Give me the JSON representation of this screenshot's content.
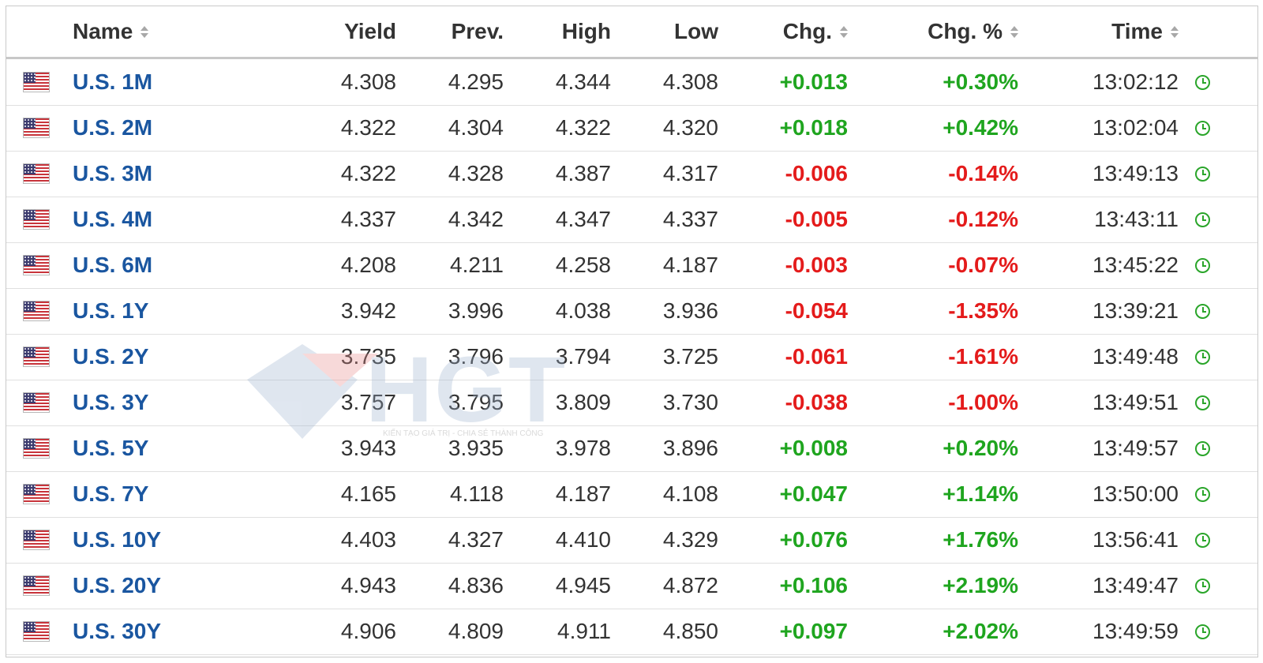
{
  "headers": {
    "name": "Name",
    "yield": "Yield",
    "prev": "Prev.",
    "high": "High",
    "low": "Low",
    "chg": "Chg.",
    "chg_pct": "Chg. %",
    "time": "Time"
  },
  "colors": {
    "up": "#1fa51f",
    "down": "#e41b1b",
    "link": "#1a56a0",
    "clock": "#2aa52a"
  },
  "rows": [
    {
      "name": "U.S. 1M",
      "yield": "4.308",
      "prev": "4.295",
      "high": "4.344",
      "low": "4.308",
      "chg": "+0.013",
      "chg_pct": "+0.30%",
      "time": "13:02:12",
      "dir": "up"
    },
    {
      "name": "U.S. 2M",
      "yield": "4.322",
      "prev": "4.304",
      "high": "4.322",
      "low": "4.320",
      "chg": "+0.018",
      "chg_pct": "+0.42%",
      "time": "13:02:04",
      "dir": "up"
    },
    {
      "name": "U.S. 3M",
      "yield": "4.322",
      "prev": "4.328",
      "high": "4.387",
      "low": "4.317",
      "chg": "-0.006",
      "chg_pct": "-0.14%",
      "time": "13:49:13",
      "dir": "down"
    },
    {
      "name": "U.S. 4M",
      "yield": "4.337",
      "prev": "4.342",
      "high": "4.347",
      "low": "4.337",
      "chg": "-0.005",
      "chg_pct": "-0.12%",
      "time": "13:43:11",
      "dir": "down"
    },
    {
      "name": "U.S. 6M",
      "yield": "4.208",
      "prev": "4.211",
      "high": "4.258",
      "low": "4.187",
      "chg": "-0.003",
      "chg_pct": "-0.07%",
      "time": "13:45:22",
      "dir": "down"
    },
    {
      "name": "U.S. 1Y",
      "yield": "3.942",
      "prev": "3.996",
      "high": "4.038",
      "low": "3.936",
      "chg": "-0.054",
      "chg_pct": "-1.35%",
      "time": "13:39:21",
      "dir": "down"
    },
    {
      "name": "U.S. 2Y",
      "yield": "3.735",
      "prev": "3.796",
      "high": "3.794",
      "low": "3.725",
      "chg": "-0.061",
      "chg_pct": "-1.61%",
      "time": "13:49:48",
      "dir": "down"
    },
    {
      "name": "U.S. 3Y",
      "yield": "3.757",
      "prev": "3.795",
      "high": "3.809",
      "low": "3.730",
      "chg": "-0.038",
      "chg_pct": "-1.00%",
      "time": "13:49:51",
      "dir": "down"
    },
    {
      "name": "U.S. 5Y",
      "yield": "3.943",
      "prev": "3.935",
      "high": "3.978",
      "low": "3.896",
      "chg": "+0.008",
      "chg_pct": "+0.20%",
      "time": "13:49:57",
      "dir": "up"
    },
    {
      "name": "U.S. 7Y",
      "yield": "4.165",
      "prev": "4.118",
      "high": "4.187",
      "low": "4.108",
      "chg": "+0.047",
      "chg_pct": "+1.14%",
      "time": "13:50:00",
      "dir": "up"
    },
    {
      "name": "U.S. 10Y",
      "yield": "4.403",
      "prev": "4.327",
      "high": "4.410",
      "low": "4.329",
      "chg": "+0.076",
      "chg_pct": "+1.76%",
      "time": "13:56:41",
      "dir": "up"
    },
    {
      "name": "U.S. 20Y",
      "yield": "4.943",
      "prev": "4.836",
      "high": "4.945",
      "low": "4.872",
      "chg": "+0.106",
      "chg_pct": "+2.19%",
      "time": "13:49:47",
      "dir": "up"
    },
    {
      "name": "U.S. 30Y",
      "yield": "4.906",
      "prev": "4.809",
      "high": "4.911",
      "low": "4.850",
      "chg": "+0.097",
      "chg_pct": "+2.02%",
      "time": "13:49:59",
      "dir": "up"
    }
  ],
  "watermark": {
    "logo_text": "HGT",
    "tagline": "KIẾN TẠO GIÁ TRỊ - CHIA SẺ THÀNH CÔNG"
  }
}
